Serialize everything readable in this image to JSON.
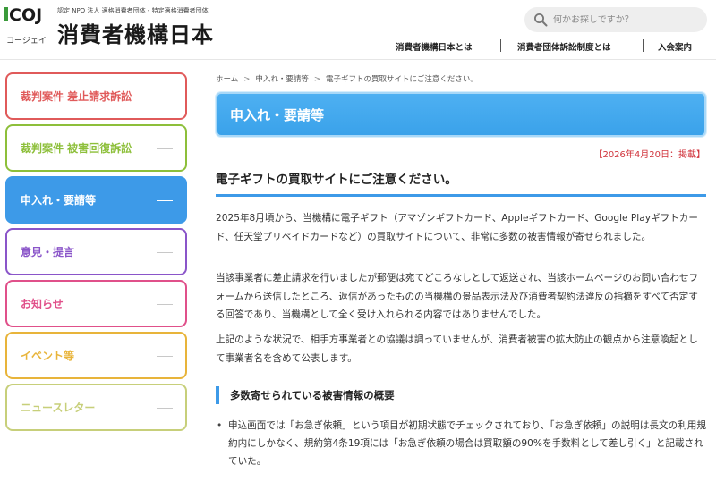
{
  "header": {
    "logo_text": "COJ",
    "logo_sub": "コージェイ",
    "tagline": "認定 NPO 法人 適格消費者団体・特定適格消費者団体",
    "org_name": "消費者機構日本",
    "search": {
      "placeholder": "何かお探しですか？",
      "icon": "search-icon"
    },
    "nav": [
      {
        "label": "消費者機構日本とは"
      },
      {
        "label": "消費者団体訴訟制度とは"
      },
      {
        "label": "入会案内"
      }
    ]
  },
  "sidebar": {
    "items": [
      {
        "label": "裁判案件 差止請求訴訟",
        "color": "#e05a5a",
        "active": false
      },
      {
        "label": "裁判案件 被害回復訴訟",
        "color": "#8dbf3a",
        "active": false
      },
      {
        "label": "申入れ・要請等",
        "color": "#3d9ae8",
        "active": true
      },
      {
        "label": "意見・提言",
        "color": "#8a55c9",
        "active": false
      },
      {
        "label": "お知らせ",
        "color": "#e0508a",
        "active": false
      },
      {
        "label": "イベント等",
        "color": "#e8b43a",
        "active": false
      },
      {
        "label": "ニュースレター",
        "color": "#c7cf7a",
        "active": false
      }
    ]
  },
  "breadcrumb": {
    "items": [
      "ホーム",
      "申入れ・要請等",
      "電子ギフトの買取サイトにご注意ください。"
    ],
    "separator": ">"
  },
  "main": {
    "banner_title": "申入れ・要請等",
    "post_date": "【2026年4月20日：掲載】",
    "article_title": "電子ギフトの買取サイトにご注意ください。",
    "paragraphs": [
      "2025年8月頃から、当機構に電子ギフト（アマゾンギフトカード、Appleギフトカード、Google Playギフトカード、任天堂プリペイドカードなど）の買取サイトについて、非常に多数の被害情報が寄せられました。",
      "当該事業者に差止請求を行いましたが郵便は宛てどころなしとして返送され、当該ホームページのお問い合わせフォームから送信したところ、返信があったものの当機構の景品表示法及び消費者契約法違反の指摘をすべて否定する回答であり、当機構として全く受け入れられる内容ではありませんでした。",
      "上記のような状況で、相手方事業者との協議は調っていませんが、消費者被害の拡大防止の観点から注意喚起として事業者名を含めて公表します。"
    ],
    "section_heading": "多数寄せられている被害情報の概要",
    "bullets": [
      "申込画面では「お急ぎ依頼」という項目が初期状態でチェックされており、「お急ぎ依頼」の説明は長文の利用規約内にしかなく、規約第4条19項には「お急ぎ依頼の場合は買取額の90%を手数料として差し引く」と記載されていた。"
    ],
    "accent_color": "#3d9ae8",
    "date_color": "#d0323a"
  }
}
